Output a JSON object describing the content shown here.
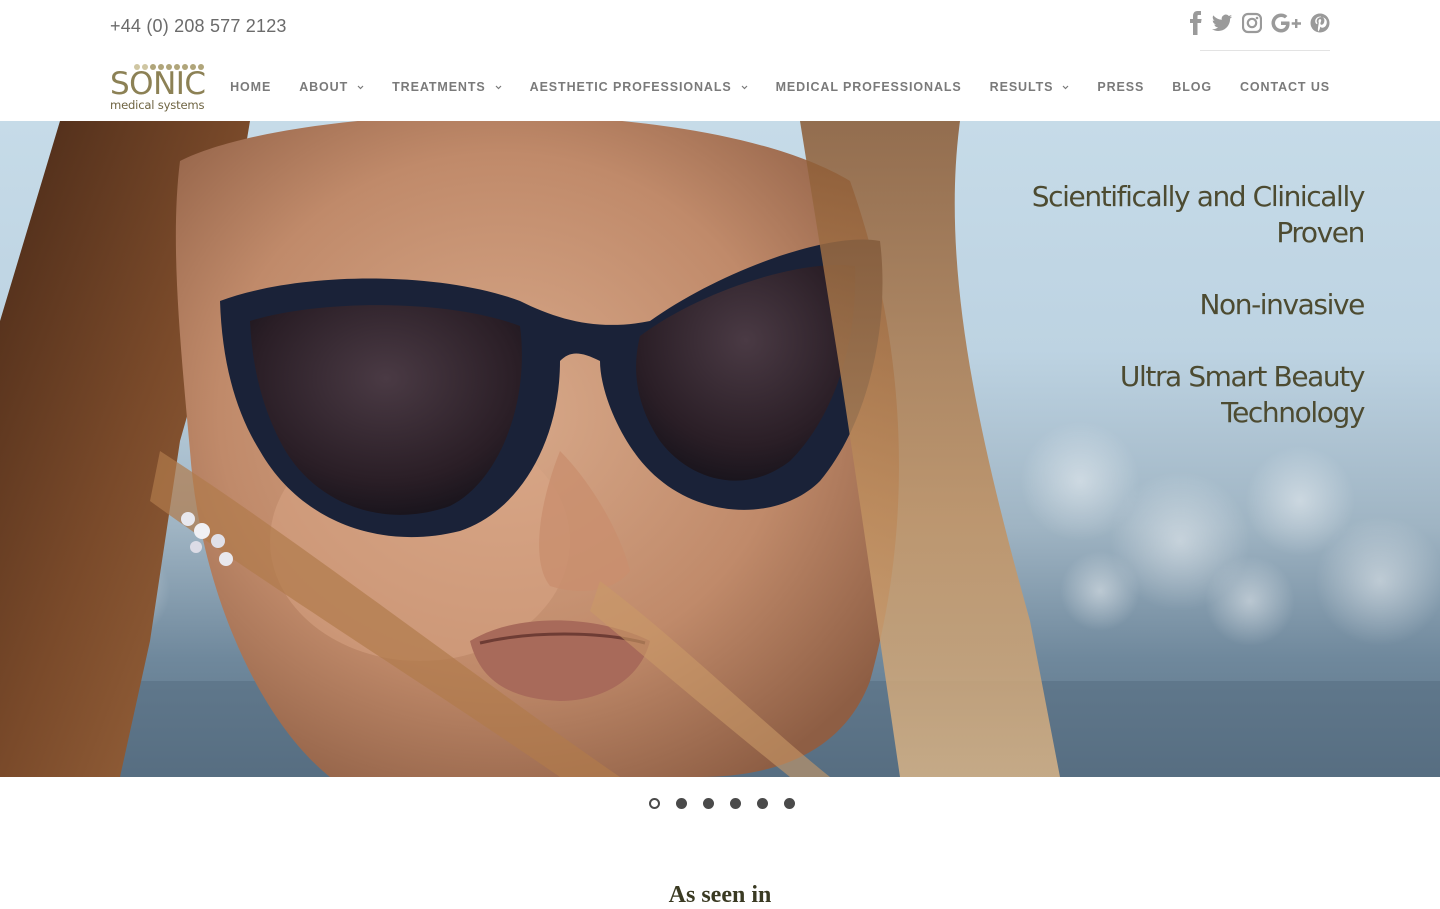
{
  "header": {
    "phone": "+44 (0) 208 577 2123",
    "social": [
      "facebook-icon",
      "twitter-icon",
      "instagram-icon",
      "google-plus-icon",
      "pinterest-icon"
    ],
    "social_color": "#9a9a9a"
  },
  "logo": {
    "name": "SONIC",
    "sub": "medical systems",
    "color": "#8c8155"
  },
  "nav": [
    {
      "label": "HOME",
      "has_dropdown": false
    },
    {
      "label": "ABOUT",
      "has_dropdown": true
    },
    {
      "label": "TREATMENTS",
      "has_dropdown": true
    },
    {
      "label": "AESTHETIC PROFESSIONALS",
      "has_dropdown": true
    },
    {
      "label": "MEDICAL PROFESSIONALS",
      "has_dropdown": false
    },
    {
      "label": "RESULTS",
      "has_dropdown": true
    },
    {
      "label": "PRESS",
      "has_dropdown": false
    },
    {
      "label": "BLOG",
      "has_dropdown": false
    },
    {
      "label": "CONTACT US",
      "has_dropdown": false
    }
  ],
  "hero": {
    "lines": [
      [
        "Scientifically and Clinically",
        "Proven"
      ],
      [
        "Non-invasive"
      ],
      [
        "Ultra Smart Beauty",
        "Technology"
      ]
    ],
    "text_color": "#4d4b31"
  },
  "slider": {
    "count": 6,
    "active": 1
  },
  "section": {
    "heading": "As seen in"
  }
}
